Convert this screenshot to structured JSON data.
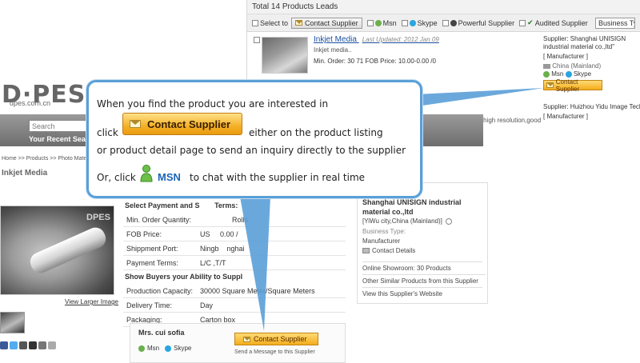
{
  "top_panel": {
    "total_prefix": "Total",
    "total_count": "14",
    "total_suffix": "Products Leads",
    "select_to": "Select to",
    "contact_btn": "Contact Supplier",
    "msn": "Msn",
    "skype": "Skype",
    "powerful": "Powerful Supplier",
    "audited": "Audited Supplier",
    "business_type": "Business Type",
    "product": {
      "title": "Inkjet Media",
      "updated": "Last Updated: 2012 Jan 09",
      "desc": "Inkjet media..",
      "min_order": "Min. Order: 30 71 FOB Price: 10.00-0.00 /0"
    },
    "supplier1": {
      "name": "Supplier: Shanghai UNISIGN industrial material co.,ltd\"",
      "type": "[ Manufacturer ]",
      "country": "China (Mainland)",
      "msn": "Msn",
      "skype": "Skype",
      "btn": "Contact Supplier"
    },
    "supplier2": {
      "name": "Supplier: Huizhou Yidu Image Technology",
      "type": "[ Manufacturer ]"
    },
    "vivid": "roperty,vivid color, high resolution,good"
  },
  "left_page": {
    "logo": "D·PES",
    "logo_url": "dpes.com.cn",
    "search_placeholder": "Search Products",
    "recent": "Your Recent Sea",
    "breadcrumb": "Home >> Products >> Photo Mate",
    "title": "Inkjet Media",
    "watermark": "DPES",
    "view_larger": "View Larger Image",
    "specs_head1": "Select Payment and S",
    "specs_head1_tail": "Terms:",
    "specs": [
      {
        "label": "Min. Order Quantity:",
        "value": "Rolls"
      },
      {
        "label": "FOB Price:",
        "value": "US     0.00 /"
      },
      {
        "label": "Shippment Port:",
        "value": "Ningb    nghai"
      },
      {
        "label": "Payment Terms:",
        "value": "L/C ,T/T"
      }
    ],
    "specs_head2": "Show Buyers your Ability to Suppl",
    "specs2": [
      {
        "label": "Production Capacity:",
        "value": "30000 Square Meter/Square Meters"
      },
      {
        "label": "Delivery Time:",
        "value": "Day"
      },
      {
        "label": "Packaging:",
        "value": "Carton box"
      }
    ],
    "card": {
      "name": "Mrs. cui sofia",
      "msn": "Msn",
      "skype": "Skype",
      "btn": "Contact Supplier",
      "msg": "Send a Message to this Supplier"
    },
    "supplier": {
      "name": "Shanghai UNISIGN industrial material co.,ltd",
      "location": "[YiWu city,China (Mainland)]",
      "bt_label": "Business Type:",
      "bt": "Manufacturer",
      "contact": "Contact Details",
      "showroom": "Online Showroom: 30 Products",
      "other": "Other Similar Products from this Supplier",
      "website": "View this Supplier's Website"
    }
  },
  "callout": {
    "line1": "When you find the product you are interested  in",
    "click": "click",
    "btn": "Contact Supplier",
    "either": "either on the product listing",
    "line3": "or product detail  page to send an inquiry directly to the supplier",
    "or_click": "Or, click",
    "msn": "MSN",
    "chat": "to chat with the supplier in real time"
  },
  "colors": {
    "callout_border": "#5a9fd8",
    "button_orange": "#f4b128",
    "link_blue": "#1a4fa0"
  }
}
